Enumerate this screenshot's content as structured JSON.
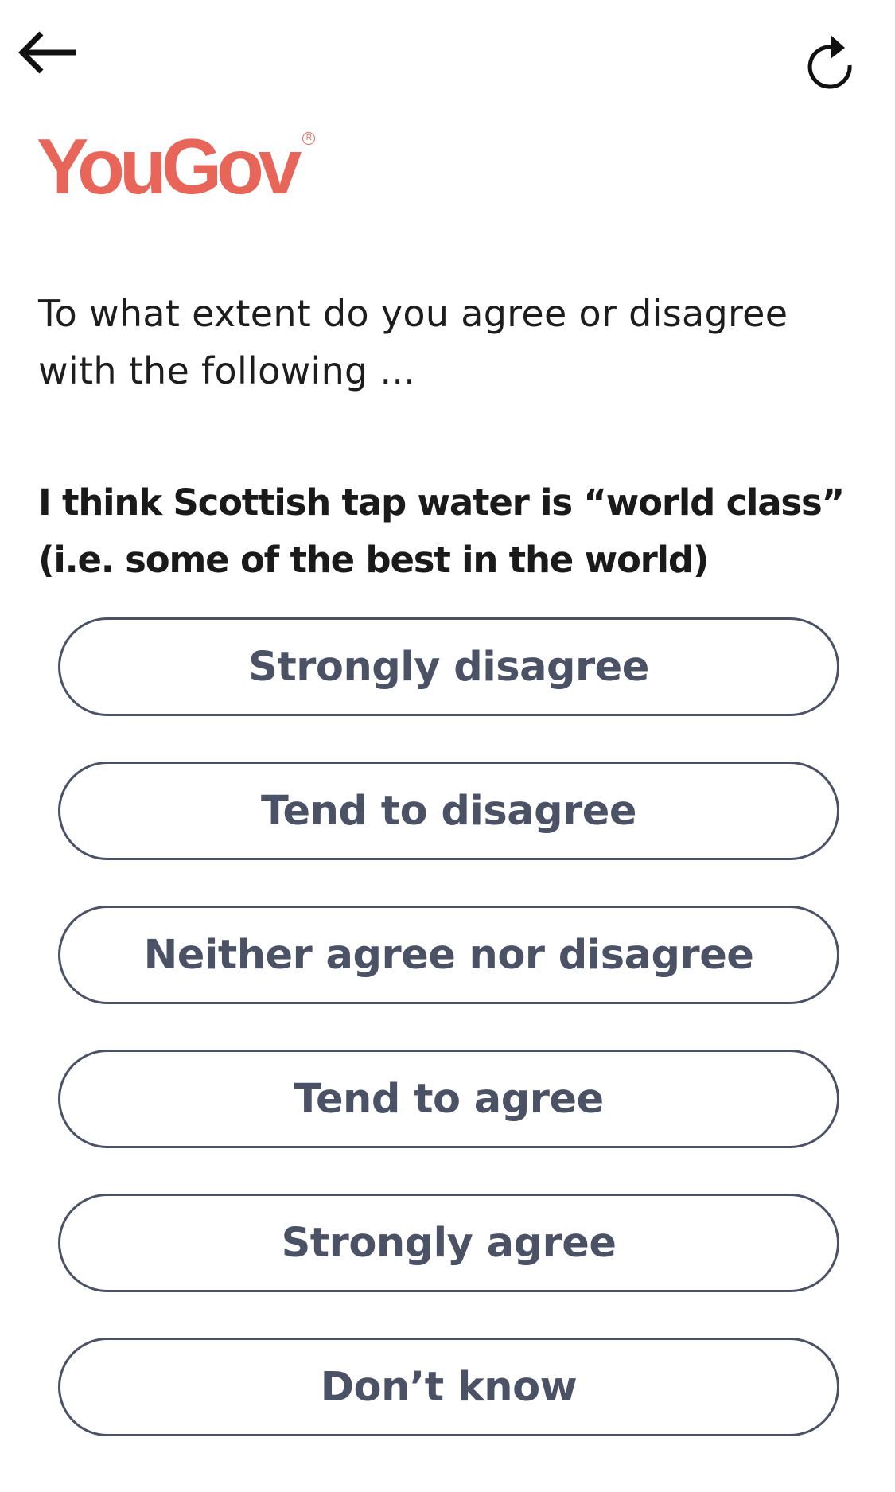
{
  "header": {
    "back_icon": "arrow-left-icon",
    "refresh_icon": "refresh-icon",
    "logo_text": "YouGov",
    "logo_reg": "R"
  },
  "question": {
    "prompt": "To what extent do you agree or disagree with the following ...",
    "statement": "I think Scottish tap water is “world class” (i.e. some of the best in the world)"
  },
  "options": [
    {
      "label": "Strongly disagree"
    },
    {
      "label": "Tend to disagree"
    },
    {
      "label": "Neither agree nor disagree"
    },
    {
      "label": "Tend to agree"
    },
    {
      "label": "Strongly agree"
    },
    {
      "label": "Don’t know"
    }
  ],
  "colors": {
    "brand": "#e8655a",
    "option_text": "#4b5266",
    "option_border": "#4b5266",
    "text": "#1d1d1d"
  }
}
